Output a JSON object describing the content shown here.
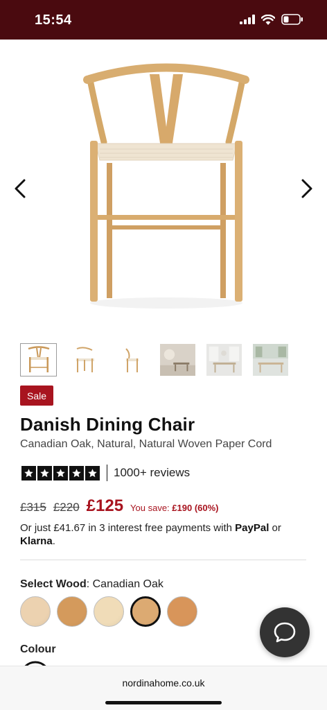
{
  "status": {
    "time": "15:54"
  },
  "product": {
    "sale_badge": "Sale",
    "title": "Danish Dining Chair",
    "subtitle": "Canadian Oak, Natural, Natural Woven Paper Cord",
    "rating": {
      "stars": 5,
      "reviews": "1000+ reviews"
    },
    "price": {
      "was_1": "£315",
      "was_2": "£220",
      "now": "£125",
      "save_prefix": "You save:",
      "save_value": "£190 (60%)"
    },
    "finance": {
      "text_1": "Or just £41.67 in 3 interest free payments with ",
      "paypal": "PayPal",
      "text_2": " or ",
      "klarna": "Klarna",
      "text_3": "."
    },
    "wood": {
      "label": "Select Wood",
      "colon": ": ",
      "selected": "Canadian Oak",
      "swatches": [
        {
          "color": "#ecd2b0"
        },
        {
          "color": "#d49a5c"
        },
        {
          "color": "#f0dcb8"
        },
        {
          "color": "#dcaa72"
        },
        {
          "color": "#d8955a"
        }
      ],
      "selected_index": 3
    },
    "colour": {
      "label": "Colour"
    }
  },
  "browser": {
    "url": "nordinahome.co.uk"
  },
  "colors": {
    "accent": "#a8141f",
    "status_bar": "#4a0a0f"
  }
}
